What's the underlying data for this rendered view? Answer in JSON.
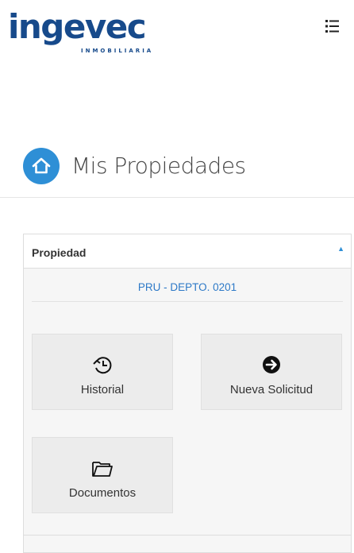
{
  "header": {
    "logo_text": "ingevec",
    "logo_subtext": "INMOBILIARIA",
    "menu_icon": "list-menu-icon"
  },
  "page": {
    "title": "Mis Propiedades",
    "title_icon": "home-icon",
    "accent_color": "#2e8fd6"
  },
  "panel": {
    "header_label": "Propiedad",
    "property_name": "PRU - DEPTO. 0201",
    "tiles": [
      {
        "label": "Historial",
        "icon": "history-icon"
      },
      {
        "label": "Nueva Solicitud",
        "icon": "arrow-circle-right-icon"
      },
      {
        "label": "Documentos",
        "icon": "folder-open-icon"
      }
    ]
  }
}
